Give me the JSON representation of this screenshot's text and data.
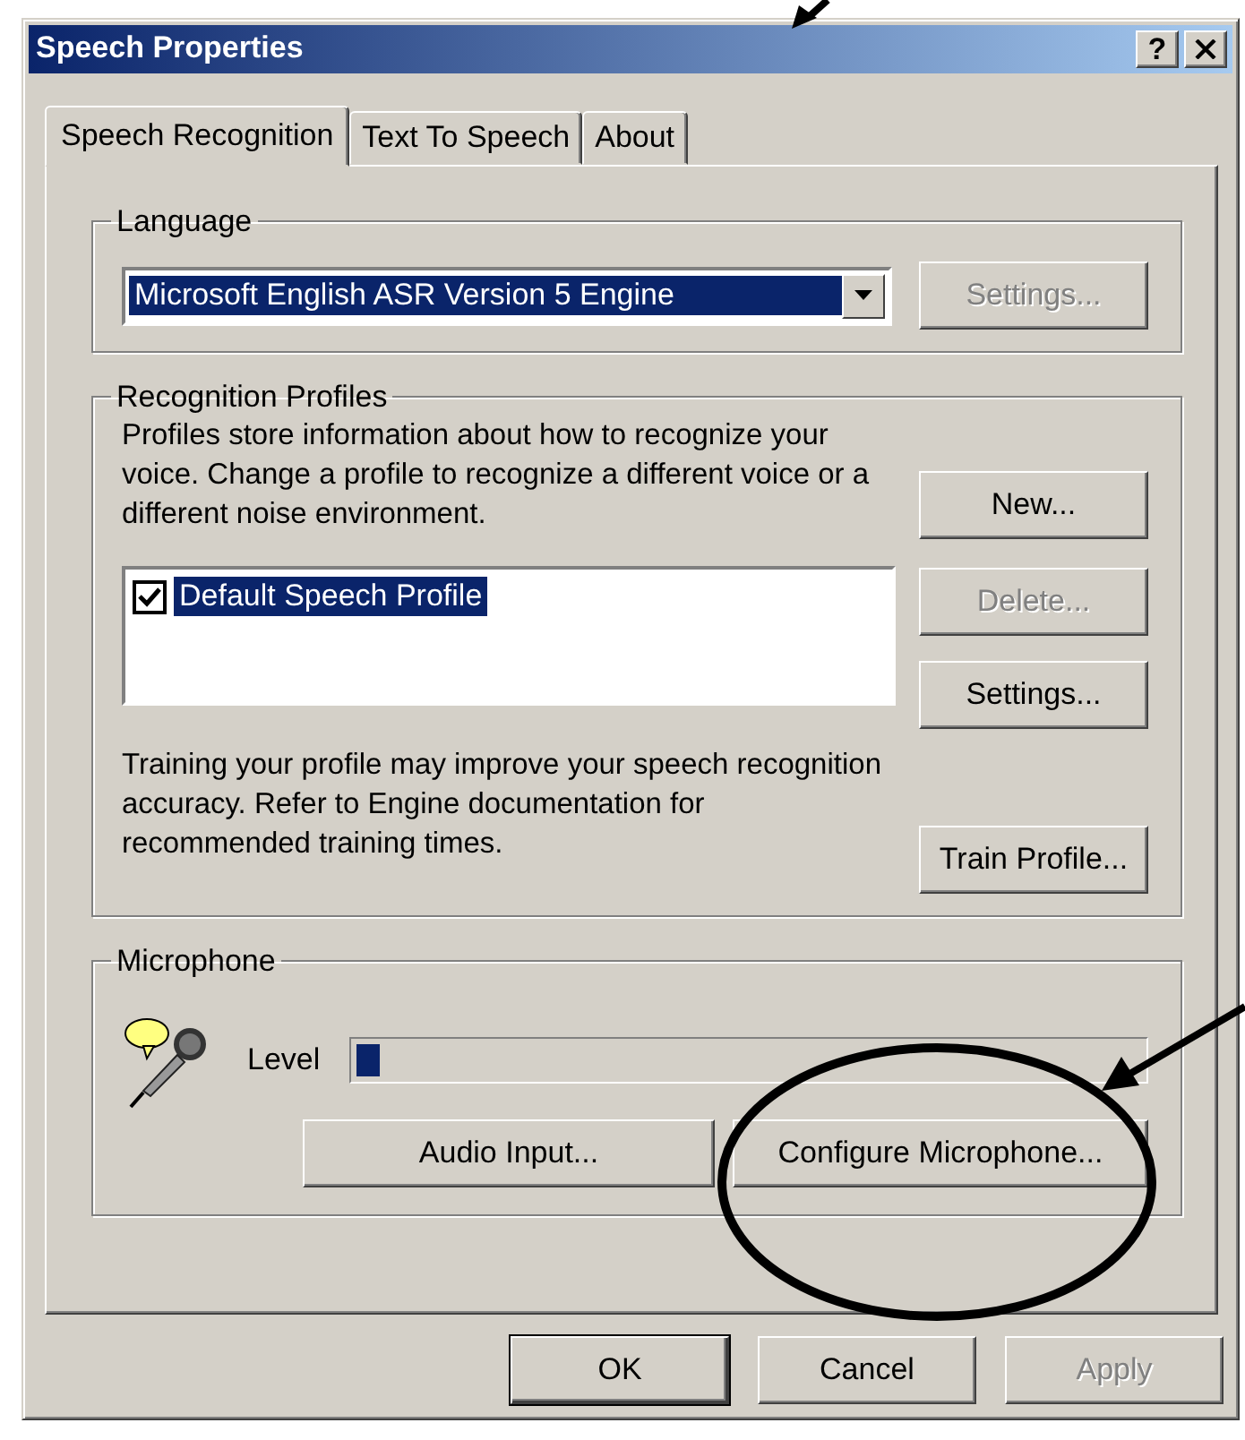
{
  "window": {
    "title": "Speech Properties",
    "help_button": "?"
  },
  "tabs": [
    {
      "label": "Speech Recognition",
      "selected": true
    },
    {
      "label": "Text To Speech",
      "selected": false
    },
    {
      "label": "About",
      "selected": false
    }
  ],
  "language": {
    "label": "Language",
    "engine": {
      "value": "Microsoft English ASR Version 5 Engine",
      "focused": true
    },
    "settings_button": {
      "label": "Settings...",
      "disabled": true
    }
  },
  "recognition_profiles": {
    "label": "Recognition Profiles",
    "description": "Profiles store information about how to recognize your voice.  Change a profile to recognize a different voice or a different noise environment.",
    "profiles": [
      {
        "name": "Default Speech Profile",
        "checked": true,
        "selected": true
      }
    ],
    "buttons": [
      {
        "label": "New...",
        "disabled": false
      },
      {
        "label": "Delete...",
        "disabled": true
      },
      {
        "label": "Settings...",
        "disabled": false
      }
    ],
    "training_text": "Training your profile may improve your speech recognition accuracy.  Refer to Engine documentation for recommended training times.",
    "train_button": {
      "label": "Train Profile...",
      "disabled": false
    }
  },
  "microphone": {
    "label": "Microphone",
    "level_label": "Level",
    "level": 0.03,
    "buttons": [
      {
        "label": "Audio Input...",
        "disabled": false
      },
      {
        "label": "Configure Microphone...",
        "disabled": false
      }
    ]
  },
  "dialog_buttons": [
    {
      "label": "OK",
      "disabled": false,
      "default": true
    },
    {
      "label": "Cancel",
      "disabled": false,
      "default": false
    },
    {
      "label": "Apply",
      "disabled": true,
      "default": false
    }
  ]
}
